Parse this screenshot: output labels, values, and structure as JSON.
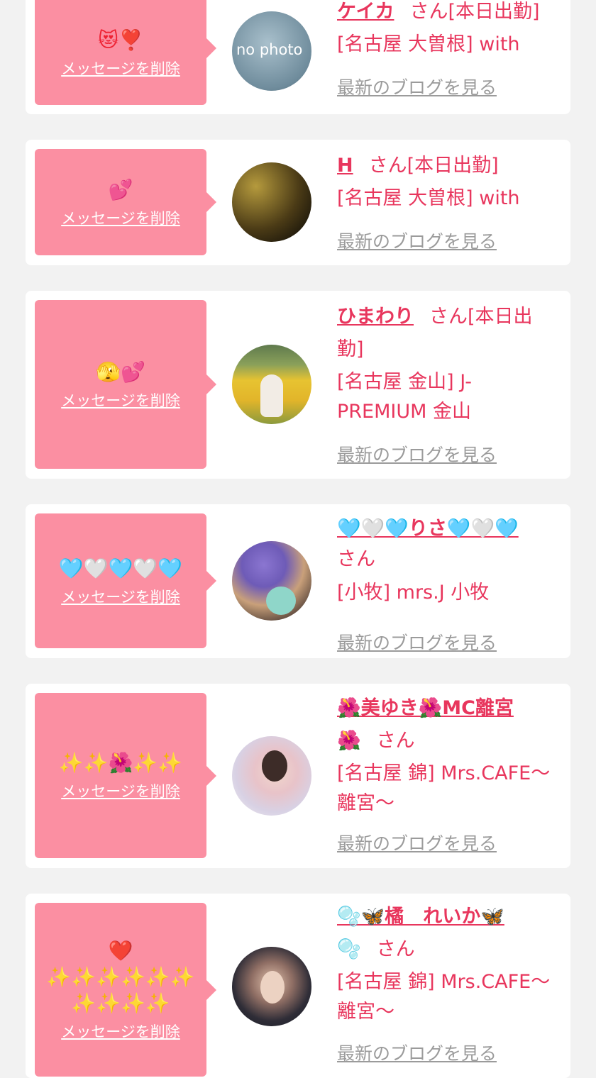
{
  "common": {
    "delete_label": "メッセージを削除",
    "blog_label": "最新のブログを見る",
    "san": "さん"
  },
  "cards": [
    {
      "emoji": "😻❣️",
      "name": "ケイカ",
      "status": "[本日出勤]",
      "shop": "[名古屋 大曽根] with",
      "avatar_text": "no photo"
    },
    {
      "emoji": "💕",
      "name": "H",
      "status": "[本日出勤]",
      "shop": "[名古屋 大曽根] with"
    },
    {
      "emoji": "🫣💕",
      "name": "ひまわり",
      "status_part1": "[本日出",
      "status_part2": "勤]",
      "shop_line1": "[名古屋 金山] J-",
      "shop_line2": "PREMIUM 金山"
    },
    {
      "emoji": "🩵🤍🩵🤍🩵",
      "name": "🩵🤍🩵りさ🩵🤍🩵",
      "shop": "[小牧] mrs.J 小牧"
    },
    {
      "emoji": "✨✨🌺✨✨",
      "name": "🌺美ゆき🌺MC離宮",
      "name_line2": "🌺",
      "shop_line1": "[名古屋 錦] Mrs.CAFE〜",
      "shop_line2": "離宮〜"
    },
    {
      "emoji_line1": "❤️",
      "emoji_line2": "✨✨✨✨✨✨",
      "emoji_line3": "✨✨✨✨",
      "name": "🫧🦋橘　れいか🦋",
      "name_line2": "🫧",
      "shop_line1": "[名古屋 錦] Mrs.CAFE〜",
      "shop_line2": "離宮〜"
    }
  ]
}
